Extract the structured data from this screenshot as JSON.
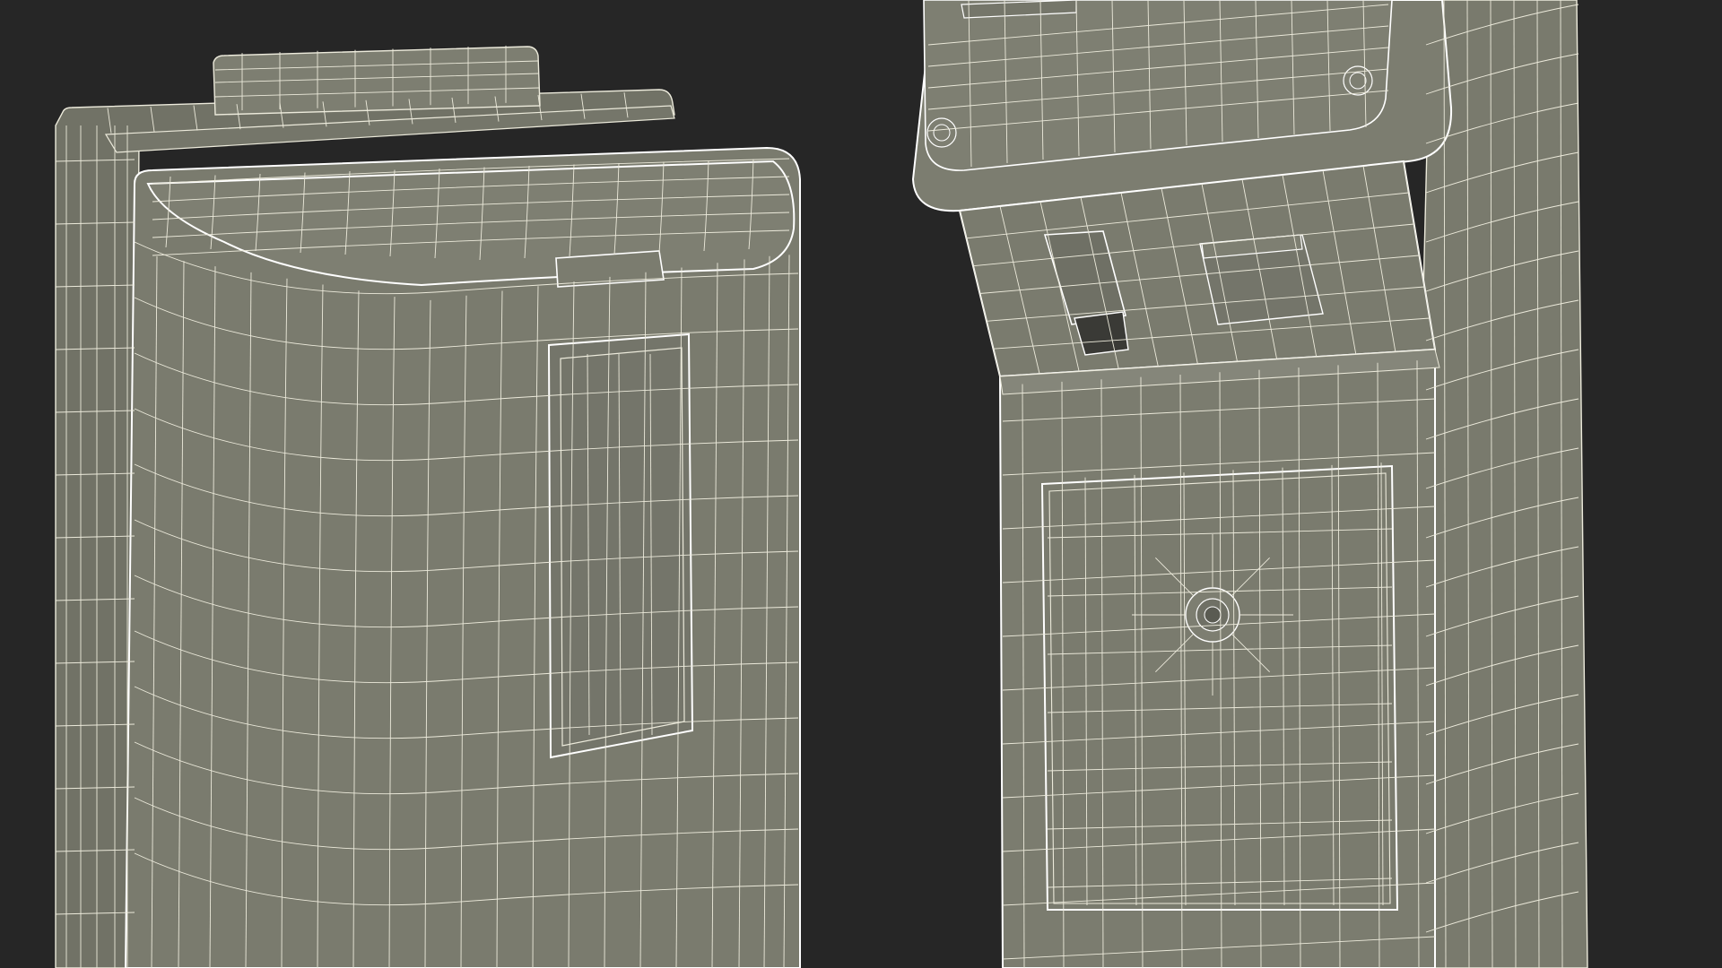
{
  "scene": {
    "description_visible_text": "",
    "colors": {
      "background": "#262626",
      "surface": "#7a7b6e",
      "surface_dark": "#6c6d61",
      "surface_light": "#85867a",
      "wire": "#eceadb",
      "wire_strong": "#ffffff"
    },
    "objects": [
      {
        "name": "kiosk-left-closeup",
        "kind": "wireframe-3d-model"
      },
      {
        "name": "kiosk-right-closeup",
        "kind": "wireframe-3d-model"
      }
    ]
  }
}
